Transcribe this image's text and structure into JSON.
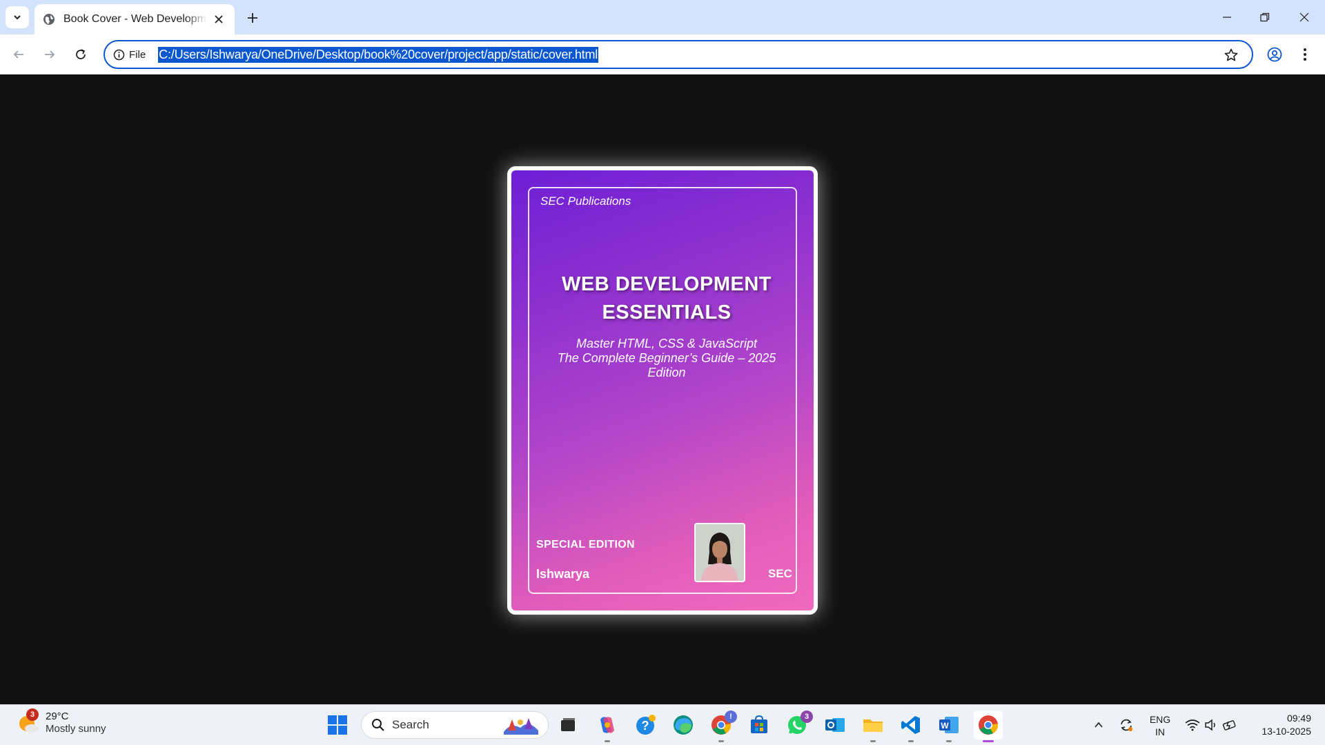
{
  "browser": {
    "tab_title": "Book Cover - Web Development",
    "site_info_label": "File",
    "url": "C:/Users/Ishwarya/OneDrive/Desktop/book%20cover/project/app/static/cover.html"
  },
  "cover": {
    "publisher": "SEC Publications",
    "title_line1": "WEB DEVELOPMENT",
    "title_line2": "ESSENTIALS",
    "subtitle_line1": "Master HTML, CSS & JavaScript",
    "subtitle_line2": "The Complete Beginner’s Guide – 2025",
    "subtitle_line3": "Edition",
    "edition": "SPECIAL EDITION",
    "author": "Ishwarya",
    "imprint": "SEC"
  },
  "taskbar": {
    "weather_badge": "3",
    "weather_temp": "29°C",
    "weather_desc": "Mostly sunny",
    "search_label": "Search",
    "chrome_badge": "!",
    "whatsapp_badge": "3",
    "lang_line1": "ENG",
    "lang_line2": "IN",
    "time": "09:49",
    "date": "13-10-2025"
  },
  "colors": {
    "accent": "#0b57d0",
    "tabbar": "#d3e3fd",
    "page_bg": "#111111",
    "cover_gradient_start": "#6d1fd6",
    "cover_gradient_end": "#f06bbd"
  }
}
